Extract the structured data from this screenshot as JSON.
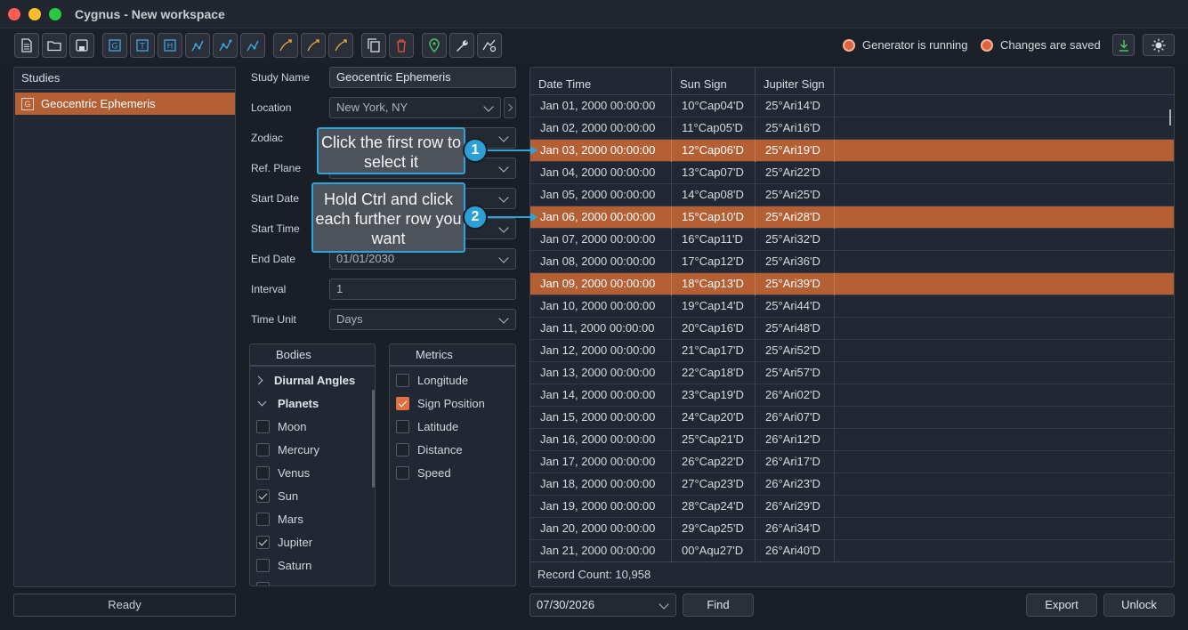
{
  "window": {
    "title": "Cygnus - New workspace"
  },
  "toolbar": {
    "icons": [
      "new-file-icon",
      "open-folder-icon",
      "save-icon",
      "g-study-icon",
      "t-study-icon",
      "h-study-icon",
      "chart-g-icon",
      "chart-t-icon",
      "chart-h-icon",
      "curve-g-icon",
      "curve-t-icon",
      "curve-h-icon",
      "copy-icon",
      "delete-icon",
      "location-pin-icon",
      "wrench-icon",
      "settings-chart-icon"
    ],
    "status_generator": "Generator is running",
    "status_saved": "Changes are saved"
  },
  "studies": {
    "header": "Studies",
    "items": [
      {
        "badge": "G",
        "label": "Geocentric Ephemeris"
      }
    ]
  },
  "form": {
    "study_name_label": "Study Name",
    "study_name_value": "Geocentric Ephemeris",
    "location_label": "Location",
    "location_value": "New York, NY",
    "zodiac_label": "Zodiac",
    "ref_plane_label": "Ref. Plane",
    "start_date_label": "Start Date",
    "start_time_label": "Start Time",
    "end_date_label": "End Date",
    "end_date_value": "01/01/2030",
    "interval_label": "Interval",
    "interval_value": "1",
    "time_unit_label": "Time Unit",
    "time_unit_value": "Days"
  },
  "bodies": {
    "header": "Bodies",
    "groups": [
      "Diurnal Angles",
      "Planets"
    ],
    "items": [
      {
        "label": "Moon",
        "checked": false
      },
      {
        "label": "Mercury",
        "checked": false
      },
      {
        "label": "Venus",
        "checked": false
      },
      {
        "label": "Sun",
        "checked": true
      },
      {
        "label": "Mars",
        "checked": false
      },
      {
        "label": "Jupiter",
        "checked": true
      },
      {
        "label": "Saturn",
        "checked": false
      }
    ]
  },
  "metrics": {
    "header": "Metrics",
    "items": [
      {
        "label": "Longitude",
        "checked": false
      },
      {
        "label": "Sign Position",
        "checked": true
      },
      {
        "label": "Latitude",
        "checked": false
      },
      {
        "label": "Distance",
        "checked": false
      },
      {
        "label": "Speed",
        "checked": false
      }
    ]
  },
  "grid": {
    "columns": [
      "Date Time",
      "Sun Sign",
      "Jupiter Sign"
    ],
    "rows": [
      [
        "Jan 01, 2000 00:00:00",
        "10°Cap04'D",
        "25°Ari14'D"
      ],
      [
        "Jan 02, 2000 00:00:00",
        "11°Cap05'D",
        "25°Ari16'D"
      ],
      [
        "Jan 03, 2000 00:00:00",
        "12°Cap06'D",
        "25°Ari19'D"
      ],
      [
        "Jan 04, 2000 00:00:00",
        "13°Cap07'D",
        "25°Ari22'D"
      ],
      [
        "Jan 05, 2000 00:00:00",
        "14°Cap08'D",
        "25°Ari25'D"
      ],
      [
        "Jan 06, 2000 00:00:00",
        "15°Cap10'D",
        "25°Ari28'D"
      ],
      [
        "Jan 07, 2000 00:00:00",
        "16°Cap11'D",
        "25°Ari32'D"
      ],
      [
        "Jan 08, 2000 00:00:00",
        "17°Cap12'D",
        "25°Ari36'D"
      ],
      [
        "Jan 09, 2000 00:00:00",
        "18°Cap13'D",
        "25°Ari39'D"
      ],
      [
        "Jan 10, 2000 00:00:00",
        "19°Cap14'D",
        "25°Ari44'D"
      ],
      [
        "Jan 11, 2000 00:00:00",
        "20°Cap16'D",
        "25°Ari48'D"
      ],
      [
        "Jan 12, 2000 00:00:00",
        "21°Cap17'D",
        "25°Ari52'D"
      ],
      [
        "Jan 13, 2000 00:00:00",
        "22°Cap18'D",
        "25°Ari57'D"
      ],
      [
        "Jan 14, 2000 00:00:00",
        "23°Cap19'D",
        "26°Ari02'D"
      ],
      [
        "Jan 15, 2000 00:00:00",
        "24°Cap20'D",
        "26°Ari07'D"
      ],
      [
        "Jan 16, 2000 00:00:00",
        "25°Cap21'D",
        "26°Ari12'D"
      ],
      [
        "Jan 17, 2000 00:00:00",
        "26°Cap22'D",
        "26°Ari17'D"
      ],
      [
        "Jan 18, 2000 00:00:00",
        "27°Cap23'D",
        "26°Ari23'D"
      ],
      [
        "Jan 19, 2000 00:00:00",
        "28°Cap24'D",
        "26°Ari29'D"
      ],
      [
        "Jan 20, 2000 00:00:00",
        "29°Cap25'D",
        "26°Ari34'D"
      ],
      [
        "Jan 21, 2000 00:00:00",
        "00°Aqu27'D",
        "26°Ari40'D"
      ]
    ],
    "selected_rows": [
      2,
      5,
      8
    ],
    "record_count": "Record Count:  10,958"
  },
  "bottom": {
    "ready": "Ready",
    "find_date": "07/30/2026",
    "find_label": "Find",
    "export_label": "Export",
    "unlock_label": "Unlock"
  },
  "callouts": {
    "step1_number": "1",
    "step1_text": "Click the first row to select it",
    "step2_number": "2",
    "step2_text": "Hold Ctrl and click each further row you want"
  },
  "colors": {
    "accent": "#b55f35",
    "callout_border": "#2fa3dc",
    "status_dot": "#e0633a"
  }
}
